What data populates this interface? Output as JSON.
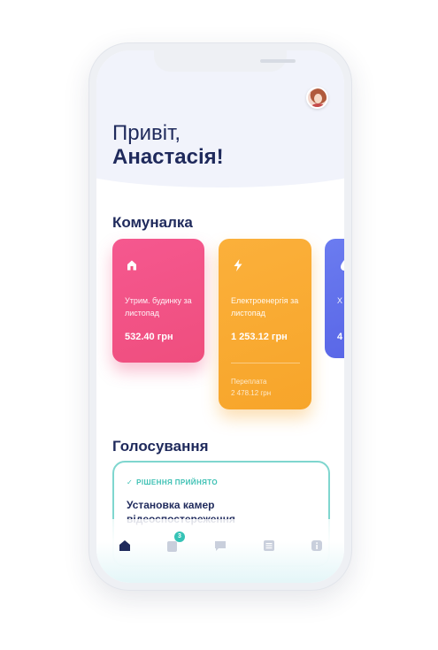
{
  "greeting": {
    "line1": "Привіт,",
    "line2": "Анастасія!"
  },
  "utilities": {
    "title": "Комуналка",
    "cards": [
      {
        "icon": "house-icon",
        "title": "Утрим. будинку за листопад",
        "amount": "532.40 грн",
        "color": "#f2527f"
      },
      {
        "icon": "lightning-icon",
        "title": "Електроенергія за листопад",
        "amount": "1 253.12 грн",
        "overpay_label": "Переплата",
        "overpay_amount": "2 478.12 грн",
        "color": "#f9aa33"
      },
      {
        "icon": "water-drop-icon",
        "title_partial": "Х",
        "amount_partial": "4",
        "color": "#5f6ee8"
      }
    ]
  },
  "voting": {
    "title": "Голосування",
    "item": {
      "status": "РІШЕННЯ ПРИЙНЯТО",
      "title": "Установка камер відеоспостереження"
    }
  },
  "nav": {
    "items": [
      {
        "icon": "home-icon",
        "active": true
      },
      {
        "icon": "notes-icon",
        "badge": "3"
      },
      {
        "icon": "chat-icon"
      },
      {
        "icon": "list-icon"
      },
      {
        "icon": "info-icon"
      }
    ],
    "active_color": "#1f2a5c",
    "inactive_color": "#c9cfdc"
  }
}
